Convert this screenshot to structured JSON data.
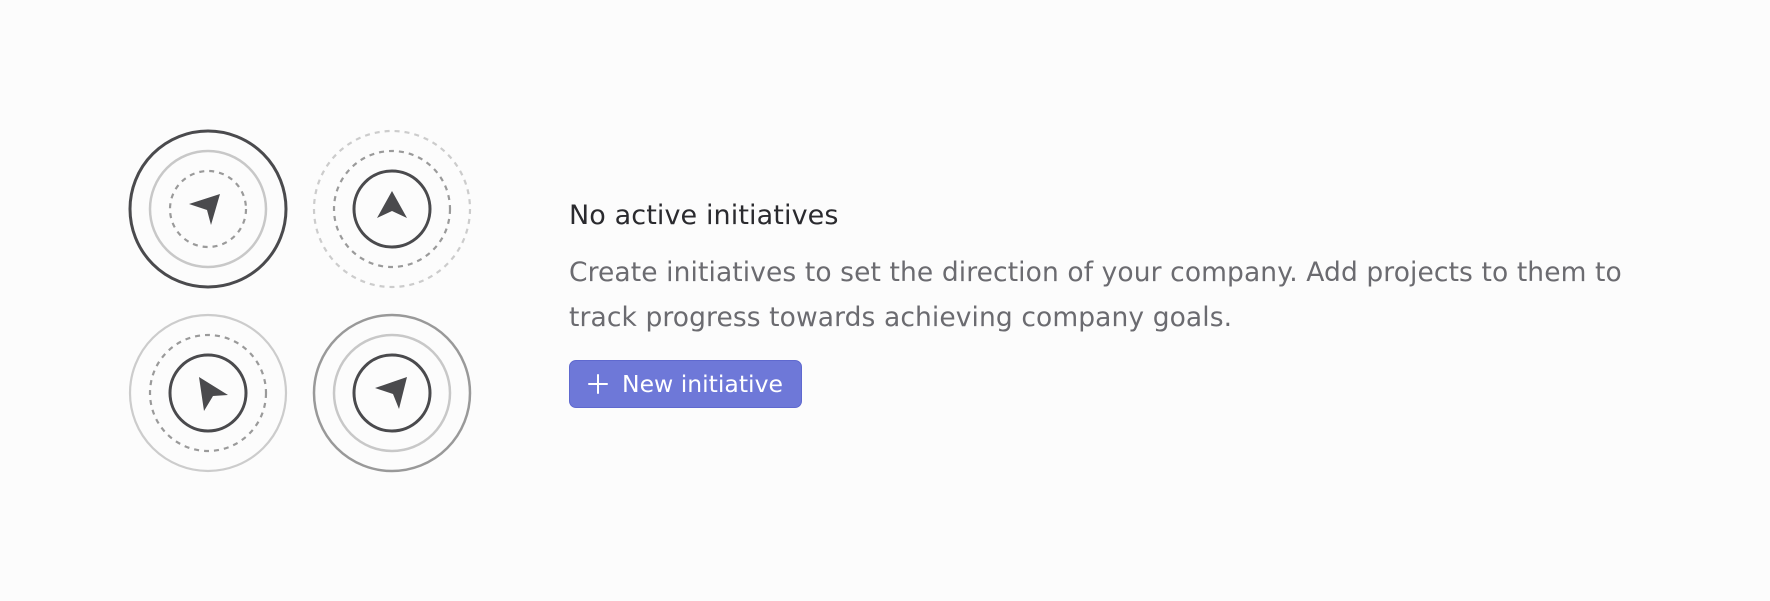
{
  "empty_state": {
    "title": "No active initiatives",
    "description": "Create initiatives to set the direction of your company. Add projects to them to track progress towards achieving company goals.",
    "button": {
      "label": "New initiative",
      "icon": "plus-icon"
    }
  },
  "illustration": {
    "icons": [
      "initiative-target-icon",
      "initiative-target-icon",
      "initiative-target-icon",
      "initiative-target-icon"
    ]
  },
  "colors": {
    "background": "#fcfcfc",
    "accent": "#6e78d8",
    "dark_stroke": "#4a4a4d",
    "mid_stroke": "#999999",
    "light_stroke": "#cccccc"
  }
}
